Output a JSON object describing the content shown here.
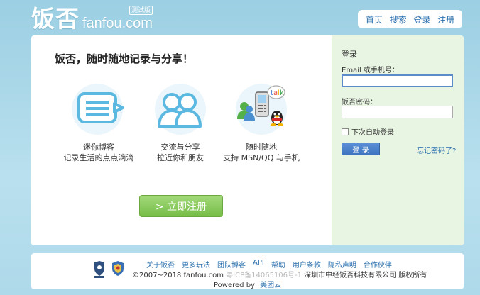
{
  "header": {
    "logo_cn": "饭否",
    "logo_en": "fanfou.com",
    "logo_badge": "测试版",
    "nav": [
      "首页",
      "搜索",
      "登录",
      "注册"
    ]
  },
  "main": {
    "headline": "饭否，随时随地记录与分享！",
    "features": [
      {
        "line1": "迷你博客",
        "line2": "记录生活的点点滴滴",
        "icon": "chat-bubble-icon"
      },
      {
        "line1": "交流与分享",
        "line2": "拉近你和朋友",
        "icon": "people-icon"
      },
      {
        "line1": "随时随地",
        "line2": "支持 MSN/QQ 与手机",
        "icon": "mobile-im-icon"
      }
    ],
    "register_button": "> 立即注册"
  },
  "login": {
    "title": "登录",
    "email_label": "Email 或手机号：",
    "email_value": "",
    "password_label": "饭否密码：",
    "password_value": "",
    "remember_label": "下次自动登录",
    "submit": "登 录",
    "forgot": "忘记密码了?"
  },
  "footer": {
    "links": [
      "关于饭否",
      "更多玩法",
      "团队博客",
      "API",
      "帮助",
      "用户条款",
      "隐私声明",
      "合作伙伴"
    ],
    "copyright": "©2007~2018 fanfou.com",
    "icp": "粤ICP备14065106号-1",
    "company": "深圳市中经饭否科技有限公司 版权所有",
    "powered_by": "Powered by",
    "powered_link": "美团云"
  },
  "colors": {
    "background": "#a6d6e6",
    "link": "#2a6fad",
    "register_green": "#77bd48",
    "login_blue": "#3f74c0",
    "login_panel": "#e9f5e3"
  }
}
